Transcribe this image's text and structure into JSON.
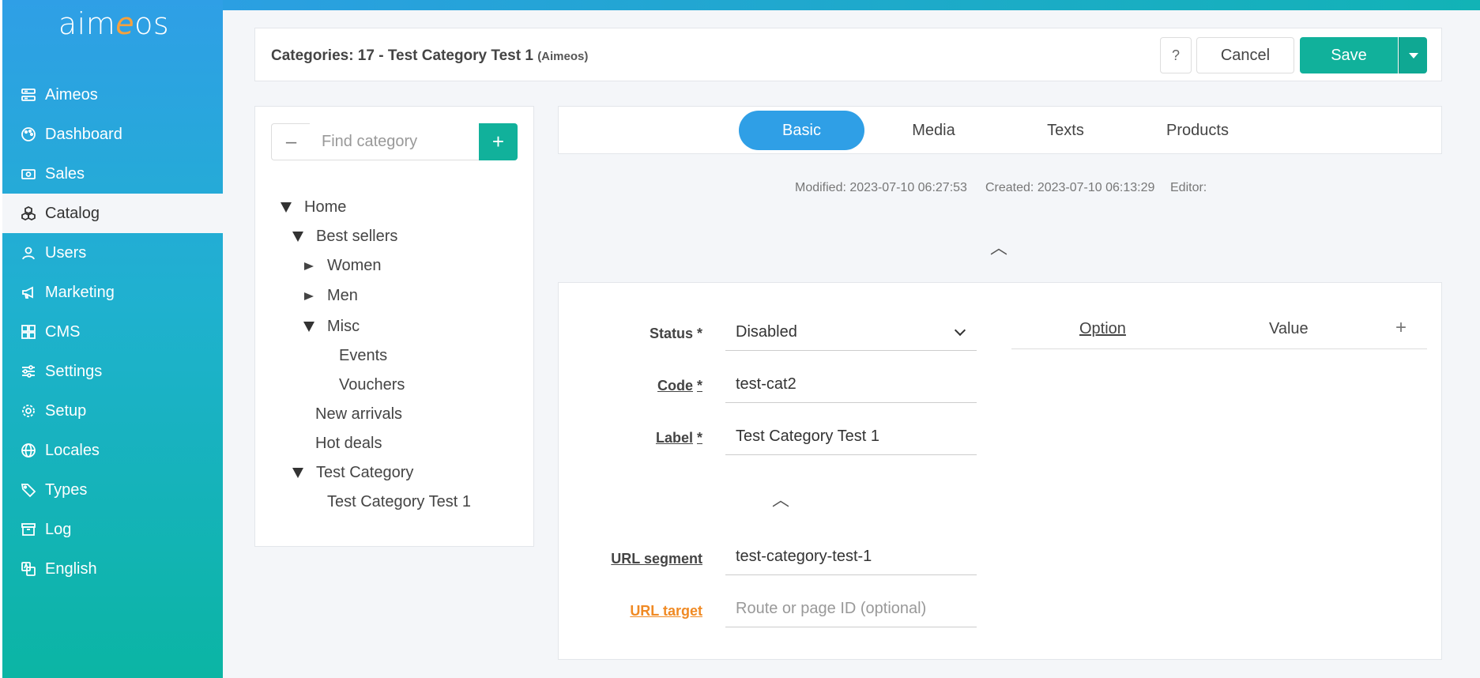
{
  "brand": {
    "logo_pre": "aim",
    "logo_e": "e",
    "logo_post": "os"
  },
  "sidebar": {
    "items": [
      {
        "label": "Aimeos",
        "icon": "server-icon"
      },
      {
        "label": "Dashboard",
        "icon": "palette-icon"
      },
      {
        "label": "Sales",
        "icon": "cash-icon"
      },
      {
        "label": "Catalog",
        "icon": "cubes-icon"
      },
      {
        "label": "Users",
        "icon": "person-icon"
      },
      {
        "label": "Marketing",
        "icon": "megaphone-icon"
      },
      {
        "label": "CMS",
        "icon": "grid-icon"
      },
      {
        "label": "Settings",
        "icon": "sliders-icon"
      },
      {
        "label": "Setup",
        "icon": "gear-icon"
      },
      {
        "label": "Locales",
        "icon": "globe-icon"
      },
      {
        "label": "Types",
        "icon": "tags-icon"
      },
      {
        "label": "Log",
        "icon": "archive-icon"
      },
      {
        "label": "English",
        "icon": "translate-icon"
      }
    ],
    "active": "Catalog"
  },
  "header": {
    "title": "Categories: 17 - Test Category Test 1",
    "site": "(Aimeos)",
    "help_label": "?",
    "cancel_label": "Cancel",
    "save_label": "Save"
  },
  "tree": {
    "search_placeholder": "Find category",
    "minus_label": "–",
    "plus_label": "+",
    "nodes": {
      "home": "Home",
      "best_sellers": "Best sellers",
      "women": "Women",
      "men": "Men",
      "misc": "Misc",
      "events": "Events",
      "vouchers": "Vouchers",
      "new_arrivals": "New arrivals",
      "hot_deals": "Hot deals",
      "test_category": "Test Category",
      "test_category_test_1": "Test Category Test 1"
    }
  },
  "tabs": {
    "basic": "Basic",
    "media": "Media",
    "texts": "Texts",
    "products": "Products",
    "active": "Basic"
  },
  "meta": {
    "modified": "Modified: 2023-07-10 06:27:53",
    "created": "Created: 2023-07-10 06:13:29",
    "editor": "Editor:"
  },
  "form": {
    "status_label": "Status *",
    "status_value": "Disabled",
    "code_label": "Code",
    "code_star": "*",
    "code_value": "test-cat2",
    "label_label": "Label",
    "label_star": "*",
    "label_value": "Test Category Test 1",
    "url_segment_label": "URL segment",
    "url_segment_value": "test-category-test-1",
    "url_target_label": "URL target",
    "url_target_placeholder": "Route or page ID (optional)"
  },
  "options": {
    "option_header": "Option",
    "value_header": "Value",
    "add_label": "+"
  },
  "colors": {
    "primary": "#2f9fe6",
    "accent": "#11b19b",
    "warning_link": "#f08a24"
  }
}
